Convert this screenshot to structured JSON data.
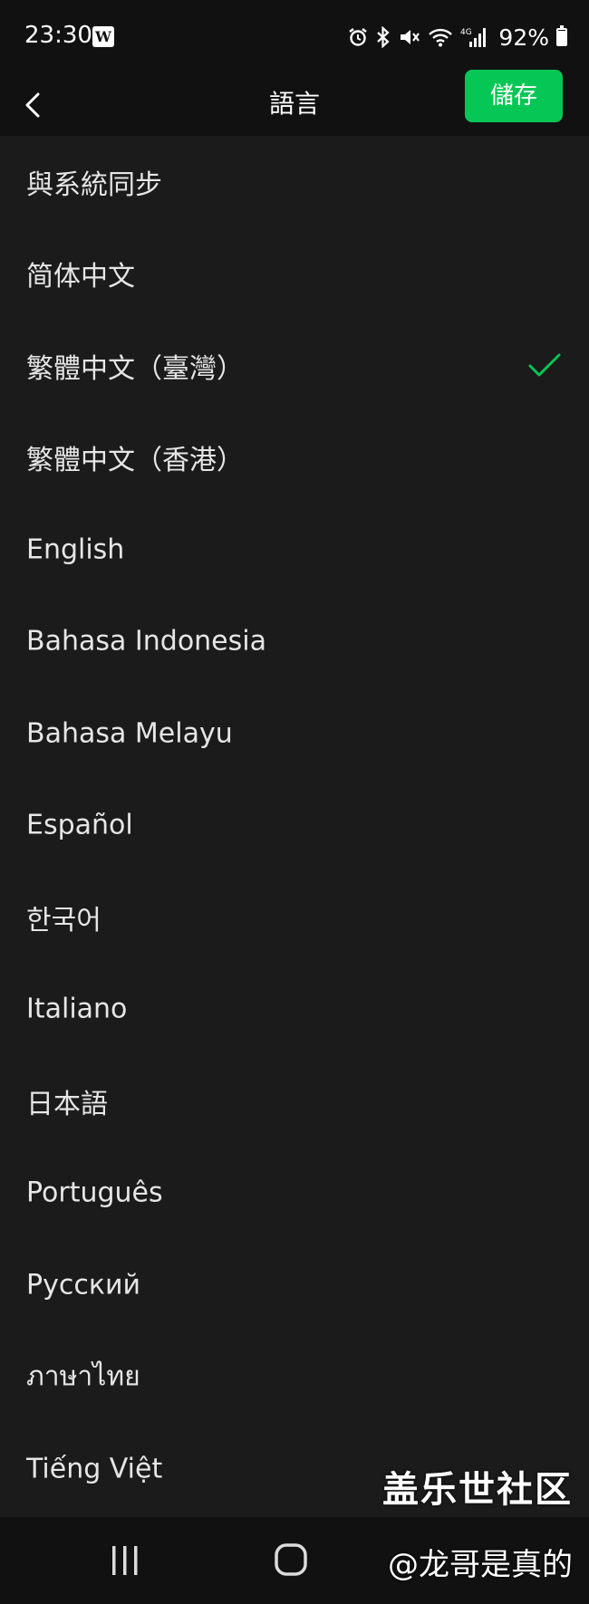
{
  "status_bar": {
    "time": "23:30",
    "app_icon_letter": "W",
    "network_label": "4G",
    "battery_text": "92%",
    "battery_level": 0.92
  },
  "header": {
    "title": "語言",
    "save_label": "儲存",
    "back_icon": "chevron-left-icon"
  },
  "languages": [
    {
      "label": "與系統同步",
      "selected": false
    },
    {
      "label": "简体中文",
      "selected": false
    },
    {
      "label": "繁體中文（臺灣）",
      "selected": true
    },
    {
      "label": "繁體中文（香港）",
      "selected": false
    },
    {
      "label": "English",
      "selected": false
    },
    {
      "label": "Bahasa Indonesia",
      "selected": false
    },
    {
      "label": "Bahasa Melayu",
      "selected": false
    },
    {
      "label": "Español",
      "selected": false
    },
    {
      "label": "한국어",
      "selected": false
    },
    {
      "label": "Italiano",
      "selected": false
    },
    {
      "label": "日本語",
      "selected": false
    },
    {
      "label": "Português",
      "selected": false
    },
    {
      "label": "Русский",
      "selected": false
    },
    {
      "label": "ภาษาไทย",
      "selected": false
    },
    {
      "label": "Tiếng Việt",
      "selected": false
    }
  ],
  "watermark": {
    "line1": "盖乐世社区",
    "line2": "@龙哥是真的"
  },
  "colors": {
    "accent": "#06c755",
    "background": "#1b1b1b",
    "bar": "#111111",
    "text": "#e6e6e6"
  }
}
